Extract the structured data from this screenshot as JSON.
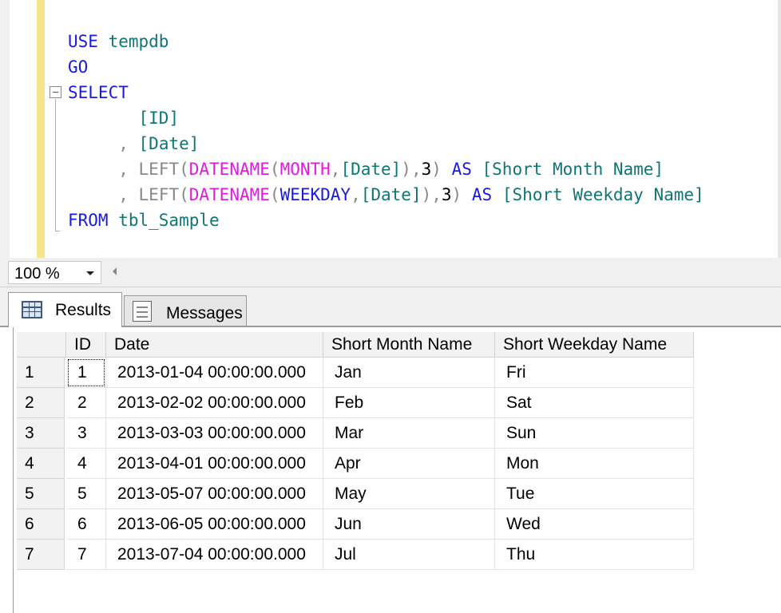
{
  "editor": {
    "lines": [
      [
        {
          "t": "USE",
          "c": "kw"
        },
        {
          "t": " tempdb",
          "c": "id"
        }
      ],
      [
        {
          "t": "GO",
          "c": "kw"
        }
      ],
      [
        {
          "t": "SELECT",
          "c": "kw"
        }
      ],
      [
        {
          "t": "       ",
          "c": "tx"
        },
        {
          "t": "[ID]",
          "c": "id"
        }
      ],
      [
        {
          "t": "     ",
          "c": "tx"
        },
        {
          "t": ",",
          "c": "op"
        },
        {
          "t": " ",
          "c": "tx"
        },
        {
          "t": "[Date]",
          "c": "id"
        }
      ],
      [
        {
          "t": "     ",
          "c": "tx"
        },
        {
          "t": ",",
          "c": "op"
        },
        {
          "t": " ",
          "c": "tx"
        },
        {
          "t": "LEFT(",
          "c": "op"
        },
        {
          "t": "DATENAME",
          "c": "fn"
        },
        {
          "t": "(",
          "c": "op"
        },
        {
          "t": "MONTH",
          "c": "fn"
        },
        {
          "t": ",",
          "c": "op"
        },
        {
          "t": "[Date]",
          "c": "id"
        },
        {
          "t": "),",
          "c": "op"
        },
        {
          "t": "3",
          "c": "tx"
        },
        {
          "t": ")",
          "c": "op"
        },
        {
          "t": " ",
          "c": "tx"
        },
        {
          "t": "AS",
          "c": "kw"
        },
        {
          "t": " ",
          "c": "tx"
        },
        {
          "t": "[Short Month Name]",
          "c": "id"
        }
      ],
      [
        {
          "t": "     ",
          "c": "tx"
        },
        {
          "t": ",",
          "c": "op"
        },
        {
          "t": " ",
          "c": "tx"
        },
        {
          "t": "LEFT(",
          "c": "op"
        },
        {
          "t": "DATENAME",
          "c": "fn"
        },
        {
          "t": "(",
          "c": "op"
        },
        {
          "t": "WEEKDAY",
          "c": "kw"
        },
        {
          "t": ",",
          "c": "op"
        },
        {
          "t": "[Date]",
          "c": "id"
        },
        {
          "t": "),",
          "c": "op"
        },
        {
          "t": "3",
          "c": "tx"
        },
        {
          "t": ")",
          "c": "op"
        },
        {
          "t": " ",
          "c": "tx"
        },
        {
          "t": "AS",
          "c": "kw"
        },
        {
          "t": " ",
          "c": "tx"
        },
        {
          "t": "[Short Weekday Name]",
          "c": "id"
        }
      ],
      [
        {
          "t": "FROM",
          "c": "kw"
        },
        {
          "t": " tbl_Sample",
          "c": "id"
        }
      ]
    ]
  },
  "zoom": {
    "value": "100 %"
  },
  "tabs": {
    "results_label": "Results",
    "messages_label": "Messages"
  },
  "grid": {
    "columns": [
      "ID",
      "Date",
      "Short Month Name",
      "Short Weekday Name"
    ],
    "rows": [
      {
        "num": "1",
        "cells": [
          "1",
          "2013-01-04 00:00:00.000",
          "Jan",
          "Fri"
        ]
      },
      {
        "num": "2",
        "cells": [
          "2",
          "2013-02-02 00:00:00.000",
          "Feb",
          "Sat"
        ]
      },
      {
        "num": "3",
        "cells": [
          "3",
          "2013-03-03 00:00:00.000",
          "Mar",
          "Sun"
        ]
      },
      {
        "num": "4",
        "cells": [
          "4",
          "2013-04-01 00:00:00.000",
          "Apr",
          "Mon"
        ]
      },
      {
        "num": "5",
        "cells": [
          "5",
          "2013-05-07 00:00:00.000",
          "May",
          "Tue"
        ]
      },
      {
        "num": "6",
        "cells": [
          "6",
          "2013-06-05 00:00:00.000",
          "Jun",
          "Wed"
        ]
      },
      {
        "num": "7",
        "cells": [
          "7",
          "2013-07-04 00:00:00.000",
          "Jul",
          "Thu"
        ]
      }
    ]
  }
}
